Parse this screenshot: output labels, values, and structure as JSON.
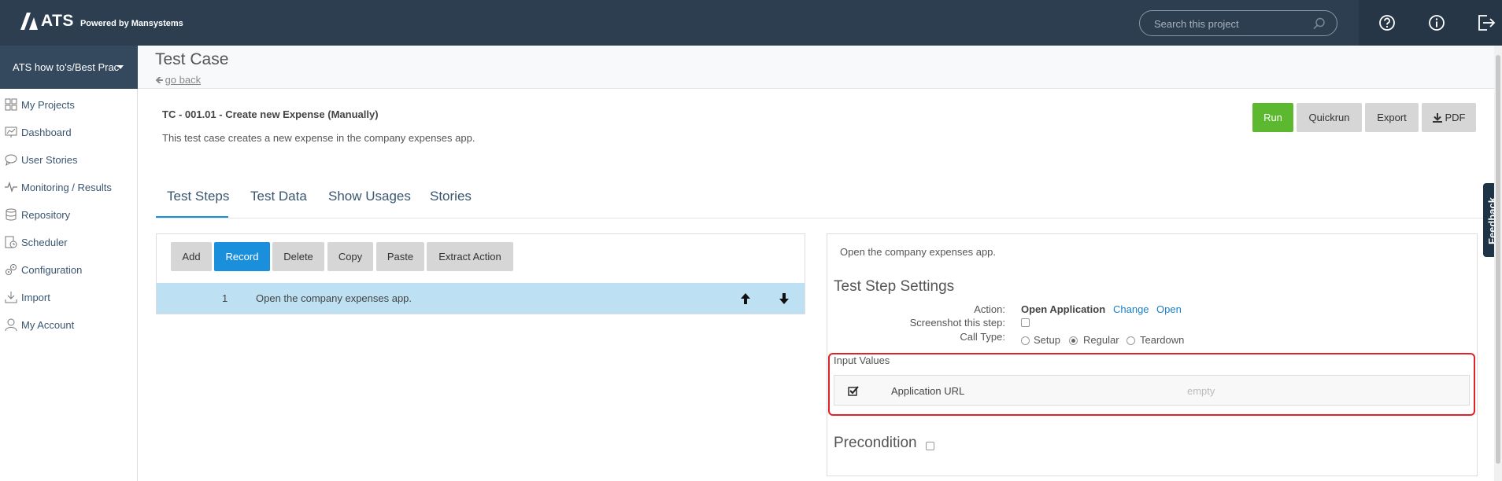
{
  "brand": {
    "name": "ATS",
    "tagline": "Powered by Mansystems"
  },
  "search": {
    "placeholder": "Search this project"
  },
  "top_icons": [
    "help-icon",
    "info-icon",
    "logout-icon"
  ],
  "sidebar": {
    "project": "ATS how to's/Best Prac",
    "items": [
      {
        "label": "My Projects",
        "icon": "projects-icon"
      },
      {
        "label": "Dashboard",
        "icon": "dashboard-icon"
      },
      {
        "label": "User Stories",
        "icon": "user-stories-icon"
      },
      {
        "label": "Monitoring / Results",
        "icon": "monitoring-icon"
      },
      {
        "label": "Repository",
        "icon": "repository-icon"
      },
      {
        "label": "Scheduler",
        "icon": "scheduler-icon"
      },
      {
        "label": "Configuration",
        "icon": "configuration-icon"
      },
      {
        "label": "Import",
        "icon": "import-icon"
      },
      {
        "label": "My Account",
        "icon": "account-icon"
      }
    ]
  },
  "header": {
    "title": "Test Case",
    "back": "go back"
  },
  "testcase": {
    "title": "TC - 001.01 - Create new Expense (Manually)",
    "description": "This test case creates a new expense in the company expenses app."
  },
  "actions": {
    "run": "Run",
    "quickrun": "Quickrun",
    "export": "Export",
    "pdf": "PDF"
  },
  "tabs": [
    "Test Steps",
    "Test Data",
    "Show Usages",
    "Stories"
  ],
  "toolbar": {
    "add": "Add",
    "record": "Record",
    "delete": "Delete",
    "copy": "Copy",
    "paste": "Paste",
    "extract": "Extract Action"
  },
  "steps": [
    {
      "num": "1",
      "text": "Open the company expenses app."
    }
  ],
  "details": {
    "description": "Open the company expenses app.",
    "settings_heading": "Test Step Settings",
    "action_label": "Action:",
    "action_value": "Open Application",
    "change": "Change",
    "open": "Open",
    "screenshot_label": "Screenshot this step:",
    "calltype_label": "Call Type:",
    "call_types": [
      "Setup",
      "Regular",
      "Teardown"
    ],
    "selected_call_type": "Regular",
    "input_values_label": "Input Values",
    "input": {
      "name": "Application URL",
      "value": "empty",
      "checked": true
    },
    "precondition": "Precondition"
  },
  "feedback": "Feedback",
  "colors": {
    "topbar": "#2c3e50",
    "accent": "#1a90dd",
    "run": "#5cb82e",
    "highlight": "#e0222a"
  }
}
